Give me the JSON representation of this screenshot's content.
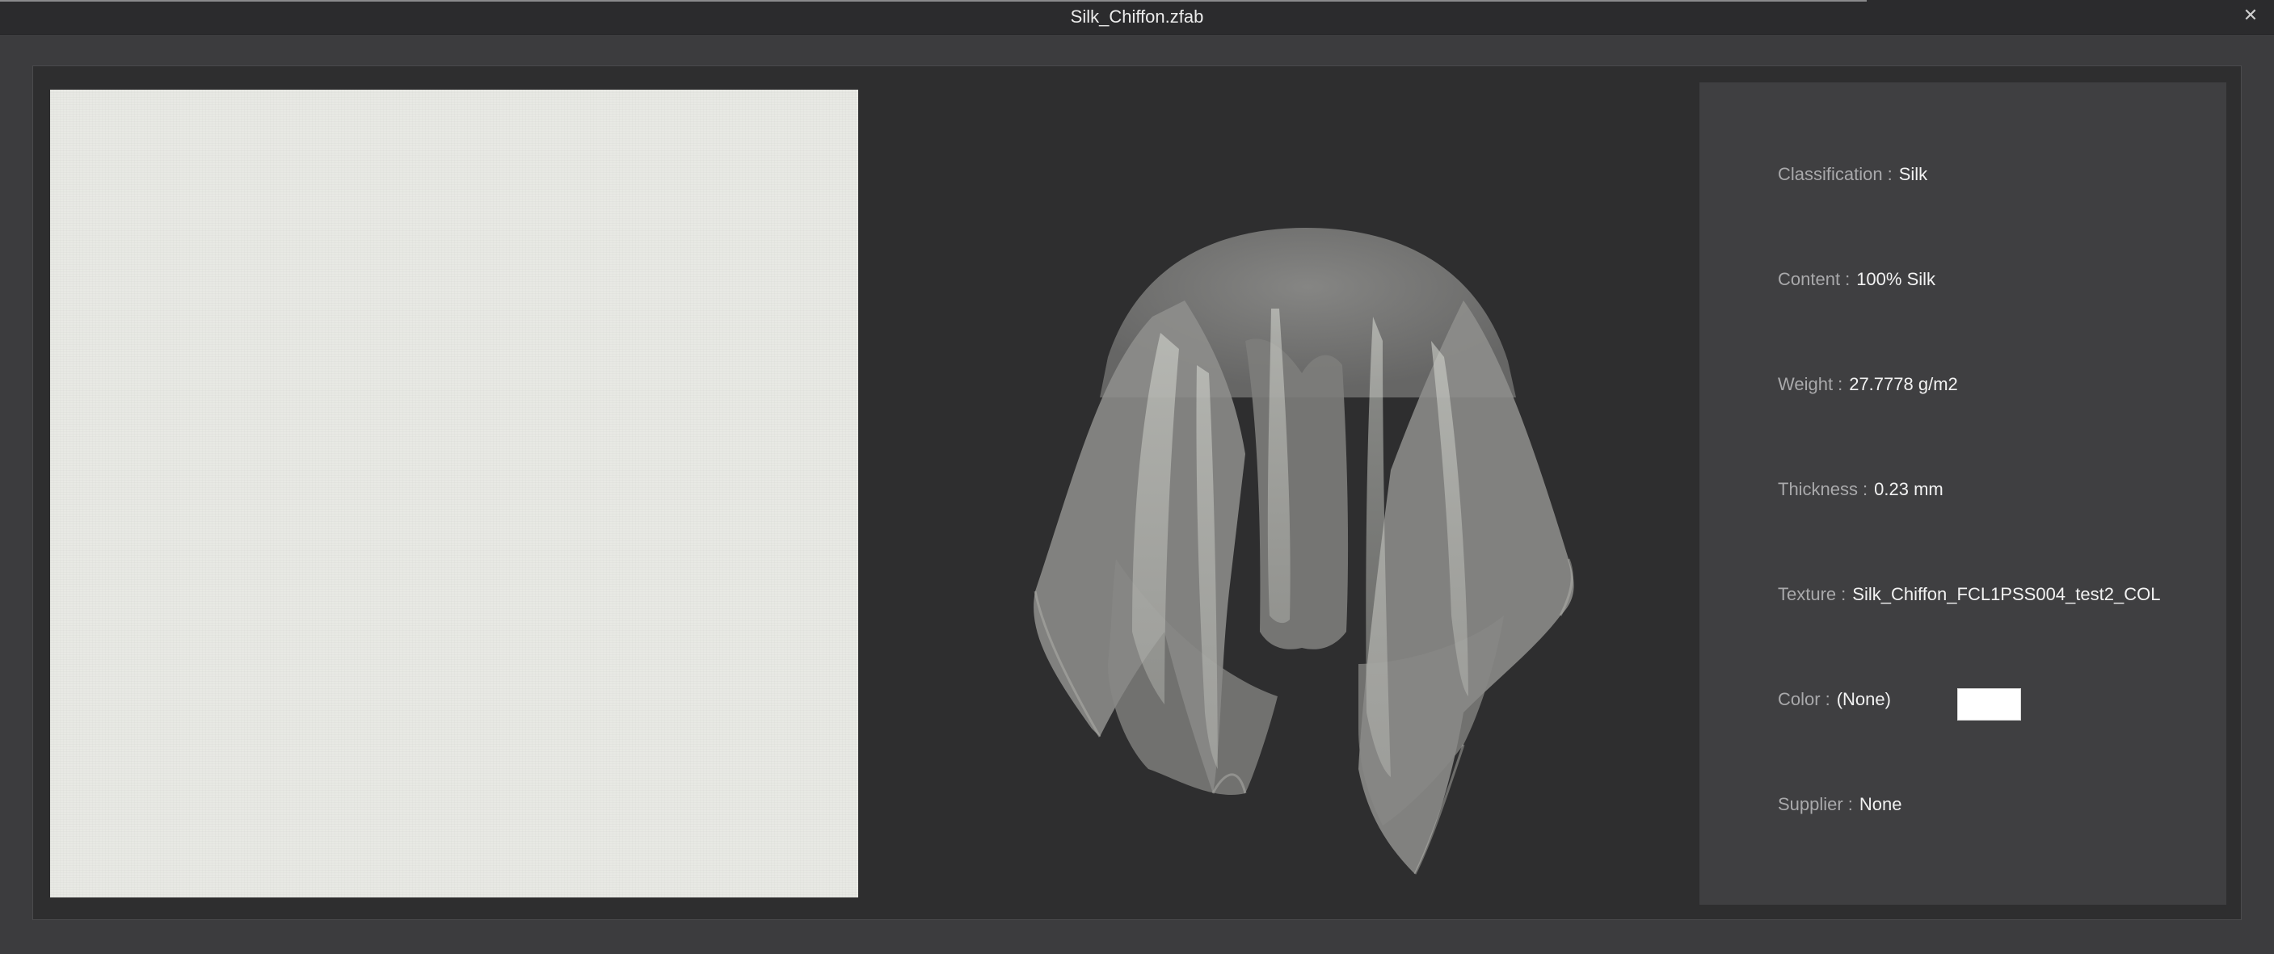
{
  "window": {
    "title": "Silk_Chiffon.zfab",
    "close_glyph": "✕"
  },
  "properties": [
    {
      "label": "Classification",
      "separator": ":",
      "value": "Silk"
    },
    {
      "label": "Content",
      "separator": ":",
      "value": "100% Silk"
    },
    {
      "label": "Weight",
      "separator": ":",
      "value": "27.7778 g/m2"
    },
    {
      "label": "Thickness",
      "separator": ":",
      "value": "0.23 mm"
    },
    {
      "label": "Texture",
      "separator": ":",
      "value": "Silk_Chiffon_FCL1PSS004_test2_COL"
    },
    {
      "label": "Color",
      "separator": ":",
      "value": "(None)"
    },
    {
      "label": "Supplier",
      "separator": ":",
      "value": "None"
    }
  ],
  "colors": {
    "swatch_fabric": "#e8e9e4",
    "color_chip": "#ffffff",
    "preview_bg": "#2e2e2f",
    "drape_fill": "#9a9a98"
  },
  "icons": {
    "close": "close-icon"
  }
}
